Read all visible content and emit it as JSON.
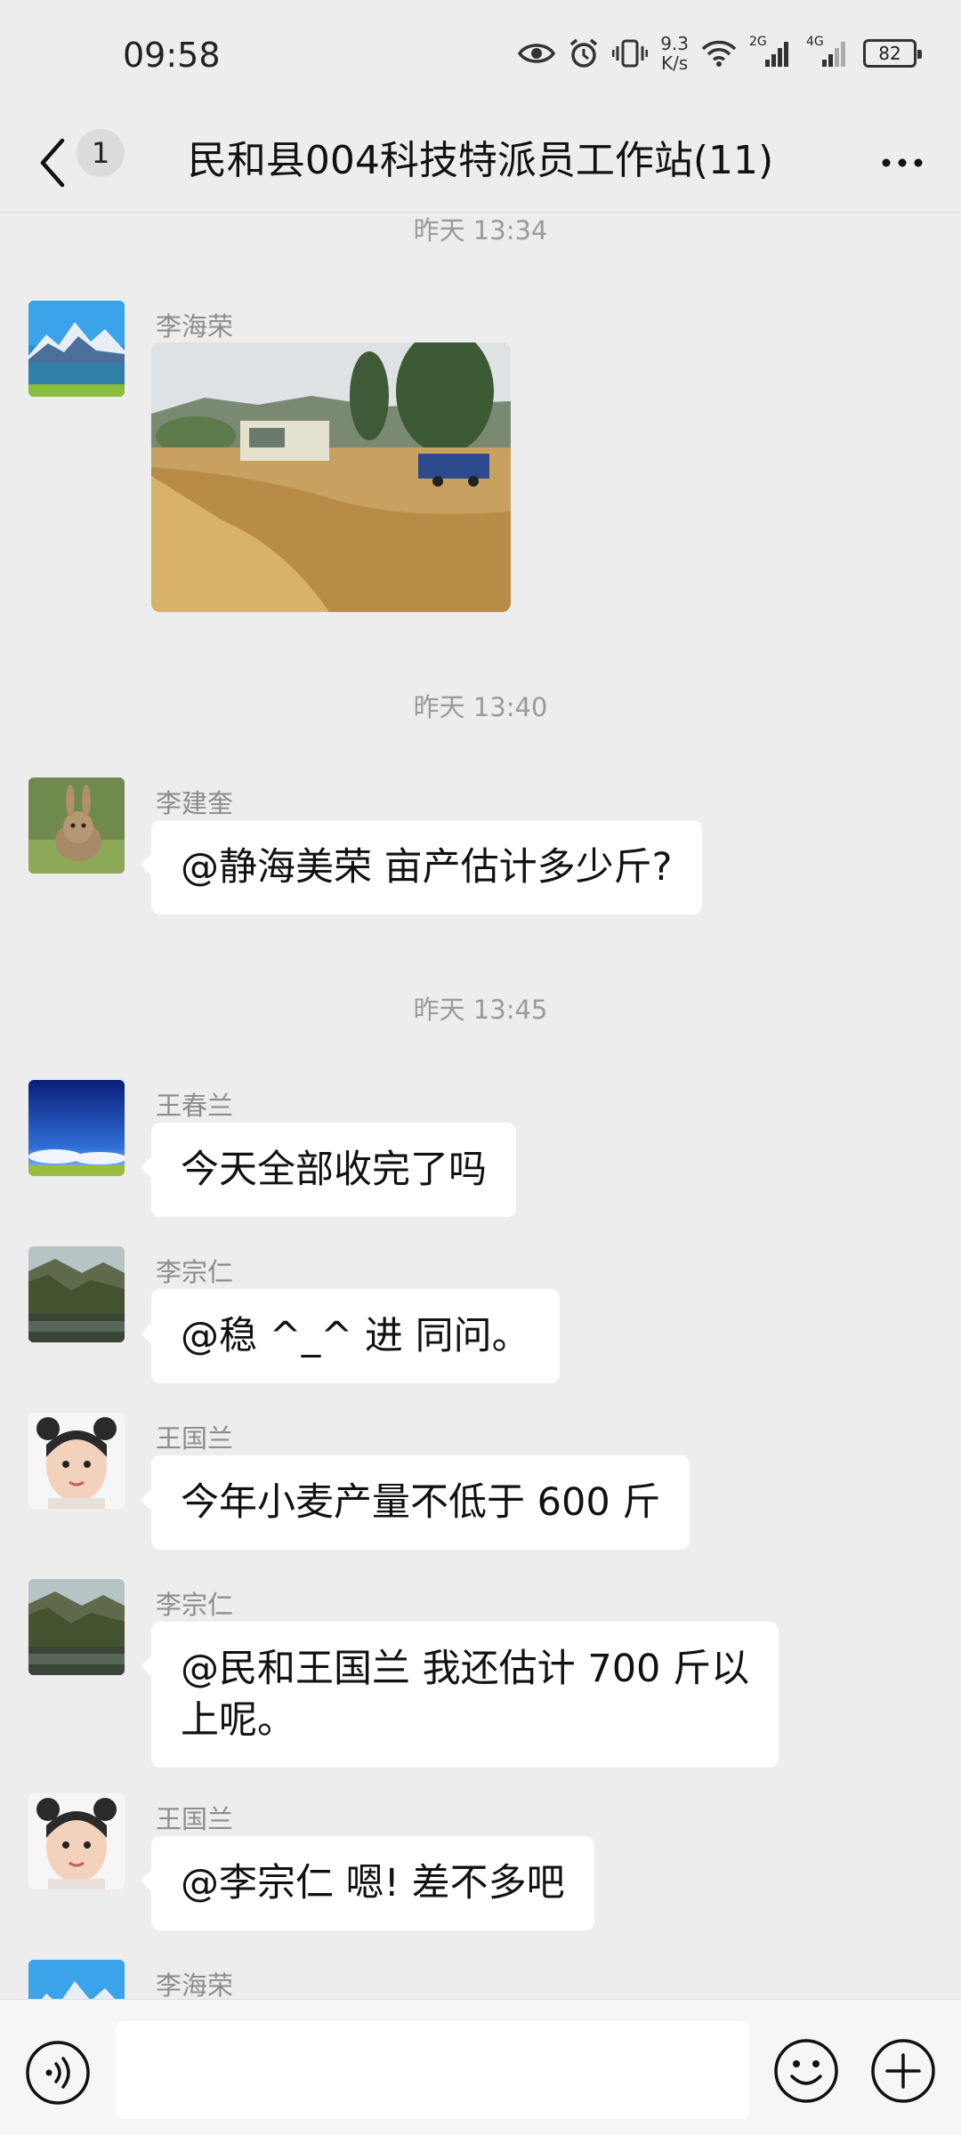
{
  "status_bar": {
    "time": "09:58",
    "net_speed_value": "9.3",
    "net_speed_unit": "K/s",
    "sim1_label": "2G",
    "sim2_label": "4G",
    "battery": "82"
  },
  "header": {
    "back_icon": "chevron-left-icon",
    "unread_count": "1",
    "title": "民和县004科技特派员工作站(11)",
    "more_icon": "more-horizontal-icon"
  },
  "messages": [
    {
      "type": "timestamp",
      "text": "昨天 13:34"
    },
    {
      "type": "image",
      "sender": "李海荣",
      "avatar": "mountain-lake-avatar"
    },
    {
      "type": "timestamp",
      "text": "昨天 13:40"
    },
    {
      "type": "text",
      "sender": "李建奎",
      "avatar": "rabbit-avatar",
      "text": "@静海美荣  亩产估计多少斤?"
    },
    {
      "type": "timestamp",
      "text": "昨天 13:45"
    },
    {
      "type": "text",
      "sender": "王春兰",
      "avatar": "blue-sky-avatar",
      "text": "今天全部收完了吗"
    },
    {
      "type": "text",
      "sender": "李宗仁",
      "avatar": "valley-avatar",
      "text": "@稳 ^_^ 进  同问。"
    },
    {
      "type": "text",
      "sender": "王国兰",
      "avatar": "child-avatar",
      "text": "今年小麦产量不低于 600 斤"
    },
    {
      "type": "text",
      "sender": "李宗仁",
      "avatar": "valley-avatar",
      "text_line1": "@民和王国兰  我还估计 700 斤以",
      "text_line2": "上呢。"
    },
    {
      "type": "text",
      "sender": "王国兰",
      "avatar": "child-avatar",
      "text": "@李宗仁  嗯!  差不多吧"
    },
    {
      "type": "partial",
      "sender": "李海荣",
      "avatar": "mountain-lake-avatar"
    }
  ],
  "input_bar": {
    "voice_icon": "voice-icon",
    "emoji_icon": "emoji-icon",
    "plus_icon": "plus-icon",
    "input_value": ""
  }
}
